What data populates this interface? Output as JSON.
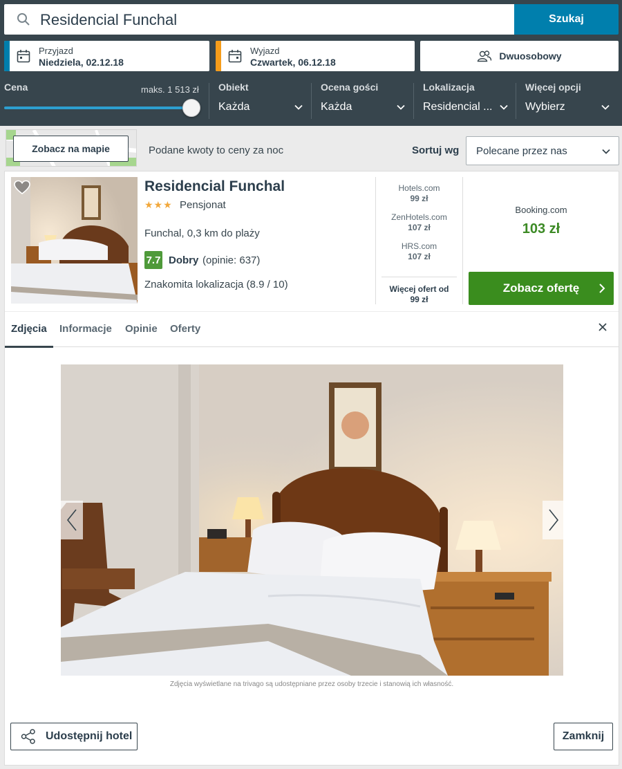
{
  "search": {
    "query": "Residencial Funchal",
    "button": "Szukaj"
  },
  "checkin": {
    "label": "Przyjazd",
    "value": "Niedziela, 02.12.18",
    "accent": "#007fad"
  },
  "checkout": {
    "label": "Wyjazd",
    "value": "Czwartek, 06.12.18",
    "accent": "#f59c1a"
  },
  "room": {
    "label": "Dwuosobowy"
  },
  "filters": {
    "price": {
      "label": "Cena",
      "max": "maks. 1 513 zł",
      "level": 1.0
    },
    "property": {
      "label": "Obiekt",
      "value": "Każda"
    },
    "rating": {
      "label": "Ocena gości",
      "value": "Każda"
    },
    "location": {
      "label": "Lokalizacja",
      "value": "Residencial ..."
    },
    "more": {
      "label": "Więcej opcji",
      "value": "Wybierz"
    }
  },
  "toolbar": {
    "map_button": "Zobacz na mapie",
    "note": "Podane kwoty to ceny za noc",
    "sort_label": "Sortuj wg",
    "sort_value": "Polecane przez nas"
  },
  "hotel": {
    "name": "Residencial Funchal",
    "stars": "★★★",
    "type": "Pensjonat",
    "location": "Funchal, 0,3 km do plaży",
    "rating_score": "7.7",
    "rating_word": "Dobry",
    "rating_count": "(opinie: 637)",
    "location_rating": "Znakomita lokalizacja (8.9 / 10)"
  },
  "deals": [
    {
      "site": "Hotels.com",
      "price": "99 zł"
    },
    {
      "site": "ZenHotels.com",
      "price": "107 zł"
    },
    {
      "site": "HRS.com",
      "price": "107 zł"
    }
  ],
  "more_offers": {
    "line1": "Więcej ofert od",
    "line2": "99 zł"
  },
  "best_deal": {
    "site": "Booking.com",
    "price": "103 zł",
    "button": "Zobacz ofertę",
    "color": "#3a8d1e"
  },
  "tabs": [
    "Zdjęcia",
    "Informacje",
    "Opinie",
    "Oferty"
  ],
  "gallery": {
    "caption": "Zdjęcia wyświetlane na trivago są udostępniane przez osoby trzecie i stanowią ich własność."
  },
  "actions": {
    "share": "Udostępnij hotel",
    "close": "Zamknij"
  }
}
